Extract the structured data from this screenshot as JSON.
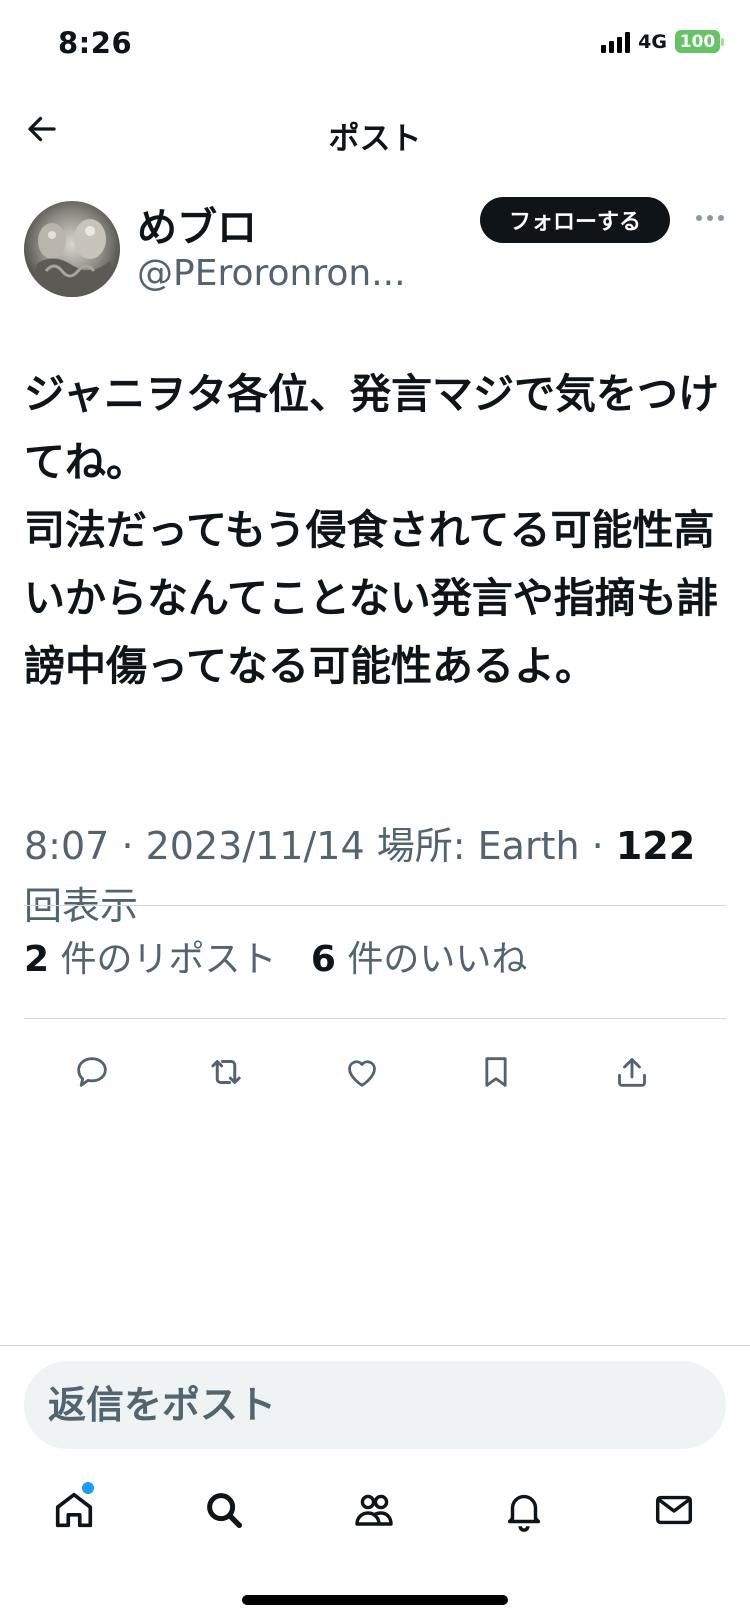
{
  "status_bar": {
    "time": "8:26",
    "network": "4G",
    "battery": "100",
    "battery_color": "#65c466"
  },
  "nav": {
    "title": "ポスト",
    "back_icon": "arrow-left-icon"
  },
  "author": {
    "display_name": "めブロ",
    "handle": "@PEroronron...",
    "follow_label": "フォローする",
    "more_icon": "more-horizontal-icon"
  },
  "post": {
    "text": "ジャニヲタ各位、発言マジで気をつけてね。\n司法だってもう侵食されてる可能性高いからなんてことない発言や指摘も誹謗中傷ってなる可能性あるよ。"
  },
  "meta": {
    "time": "8:07",
    "date": "2023/11/14",
    "location_label": "場所:",
    "location": "Earth",
    "separator": "·",
    "views_count": "122",
    "views_label": "回表示"
  },
  "stats": {
    "reposts_count": "2",
    "reposts_label": "件のリポスト",
    "likes_count": "6",
    "likes_label": "件のいいね"
  },
  "actions": [
    "reply-icon",
    "repost-icon",
    "like-icon",
    "bookmark-icon",
    "share-icon"
  ],
  "reply": {
    "placeholder": "返信をポスト"
  },
  "tab_bar": {
    "tabs": [
      "home-icon",
      "search-icon",
      "communities-icon",
      "notifications-icon",
      "messages-icon"
    ],
    "accent": "#1d9bf0"
  }
}
